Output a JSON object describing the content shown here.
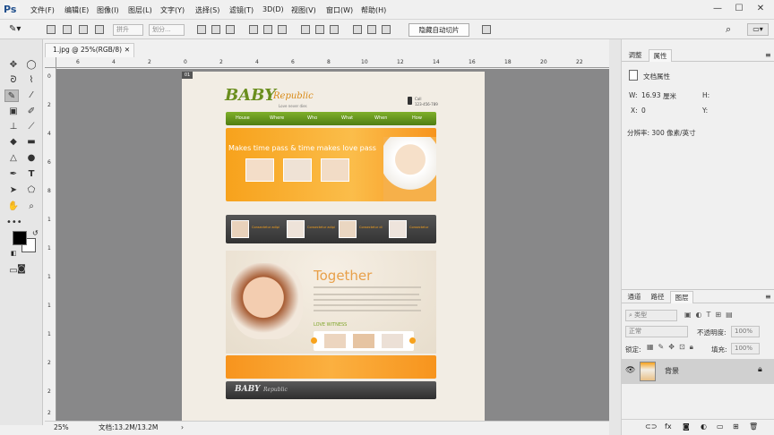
{
  "app": {
    "logo": "Ps"
  },
  "menu": [
    "文件(F)",
    "编辑(E)",
    "图像(I)",
    "图层(L)",
    "文字(Y)",
    "选择(S)",
    "滤镜(T)",
    "3D(D)",
    "视图(V)",
    "窗口(W)",
    "帮助(H)"
  ],
  "window_controls": {
    "minimize": "—",
    "maximize": "☐",
    "close": "✕"
  },
  "options": {
    "field1": "拼升",
    "field2": "划分...",
    "button": "隐藏自动切片"
  },
  "document": {
    "tab": "1.jpg @ 25%(RGB/8)",
    "close": "✕"
  },
  "ruler_top": [
    "6",
    "4",
    "2",
    "0",
    "2",
    "4",
    "6",
    "8",
    "10",
    "12",
    "14",
    "16",
    "18",
    "20",
    "22"
  ],
  "ruler_left": [
    "0",
    "2",
    "4",
    "6",
    "8",
    "1",
    "1",
    "1",
    "1",
    "1",
    "2",
    "2",
    "2"
  ],
  "status": {
    "zoom": "25%",
    "doc": "文档:13.2M/13.2M",
    "arrow": "›"
  },
  "properties": {
    "tab1": "调整",
    "tab2": "属性",
    "title": "文档属性",
    "w_label": "W:",
    "w_value": "16.93",
    "w_unit": "厘米",
    "h_label": "H:",
    "x_label": "X:",
    "x_value": "0",
    "y_label": "Y:",
    "resolution": "分辨率: 300 像素/英寸"
  },
  "layers": {
    "tabs": [
      "通道",
      "路径",
      "图层"
    ],
    "kind": "类型",
    "blend": "正常",
    "opacity_label": "不透明度:",
    "opacity": "100%",
    "lock_label": "锁定:",
    "fill_label": "填充:",
    "fill": "100%",
    "layer_name": "背景"
  },
  "webpage": {
    "brand": "BABY",
    "brand_script": "Republic",
    "brand_sub": "Love never dies",
    "call": "Call",
    "phone": "123-456-789",
    "nav": [
      "House",
      "Where",
      "Who",
      "What",
      "When",
      "How"
    ],
    "hero_text": "Makes time pass & time makes love pass",
    "thumbs_caption": [
      "Consectetur adipi",
      "Consectetur adipi",
      "Consectetur di",
      "Consectetur"
    ],
    "together": "Together",
    "love": "LOVE WITNESS",
    "footer_brand": "BABY",
    "footer_script": "Republic"
  }
}
